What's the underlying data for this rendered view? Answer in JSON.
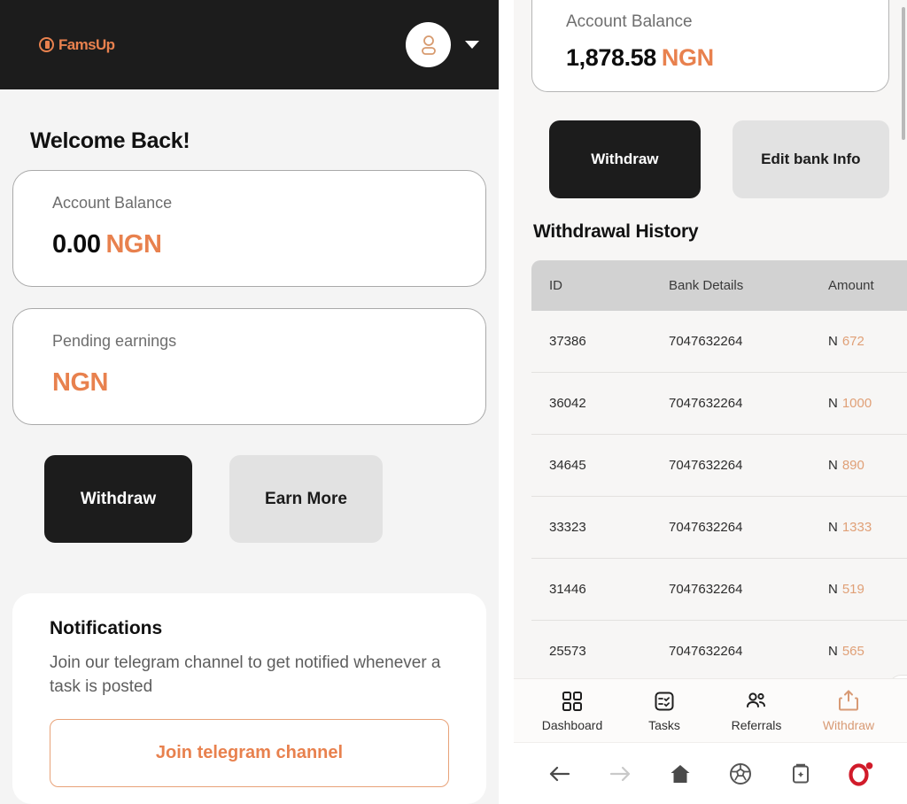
{
  "left": {
    "header": {
      "logo_text": "FamsUp",
      "logo_mark_icon": "circle-clock-icon",
      "avatar_icon": "user-avatar-icon",
      "caret_icon": "chevron-down-icon"
    },
    "welcome_title": "Welcome Back!",
    "cards": [
      {
        "label": "Account Balance",
        "amount": "0.00",
        "currency": "NGN"
      },
      {
        "label": "Pending earnings",
        "amount": "",
        "currency": "NGN"
      }
    ],
    "buttons": {
      "withdraw": "Withdraw",
      "earn_more": "Earn More"
    },
    "notifications": {
      "title": "Notifications",
      "body": "Join our telegram channel to get notified whenever a task is posted",
      "cta": "Join telegram channel"
    }
  },
  "right": {
    "balance": {
      "label": "Account Balance",
      "amount": "1,878.58",
      "currency": "NGN"
    },
    "buttons": {
      "withdraw": "Withdraw",
      "edit_bank": "Edit bank Info"
    },
    "history": {
      "title": "Withdrawal History",
      "columns": [
        "ID",
        "Bank Details",
        "Amount"
      ],
      "rows": [
        {
          "id": "37386",
          "bank": "7047632264",
          "symbol": "N",
          "amount": "672"
        },
        {
          "id": "36042",
          "bank": "7047632264",
          "symbol": "N",
          "amount": "1000"
        },
        {
          "id": "34645",
          "bank": "7047632264",
          "symbol": "N",
          "amount": "890"
        },
        {
          "id": "33323",
          "bank": "7047632264",
          "symbol": "N",
          "amount": "1333"
        },
        {
          "id": "31446",
          "bank": "7047632264",
          "symbol": "N",
          "amount": "519"
        },
        {
          "id": "25573",
          "bank": "7047632264",
          "symbol": "N",
          "amount": "565"
        }
      ]
    },
    "bottom_nav": [
      {
        "label": "Dashboard",
        "icon": "grid-icon",
        "active": false
      },
      {
        "label": "Tasks",
        "icon": "checklist-icon",
        "active": false
      },
      {
        "label": "Referrals",
        "icon": "people-icon",
        "active": false
      },
      {
        "label": "Withdraw",
        "icon": "upload-icon",
        "active": true
      }
    ],
    "browser_toolbar": [
      {
        "icon": "back-arrow-icon"
      },
      {
        "icon": "forward-arrow-icon"
      },
      {
        "icon": "home-icon"
      },
      {
        "icon": "soccer-ball-icon"
      },
      {
        "icon": "tabs-icon"
      },
      {
        "icon": "opera-logo-icon"
      }
    ]
  },
  "colors": {
    "accent_orange": "#e8814e",
    "amount_orange": "#e0a077",
    "dark": "#1c1c1c",
    "light_button": "#e2e2e2",
    "table_header": "#d2d2d2",
    "opera_red": "#d11b2a"
  }
}
